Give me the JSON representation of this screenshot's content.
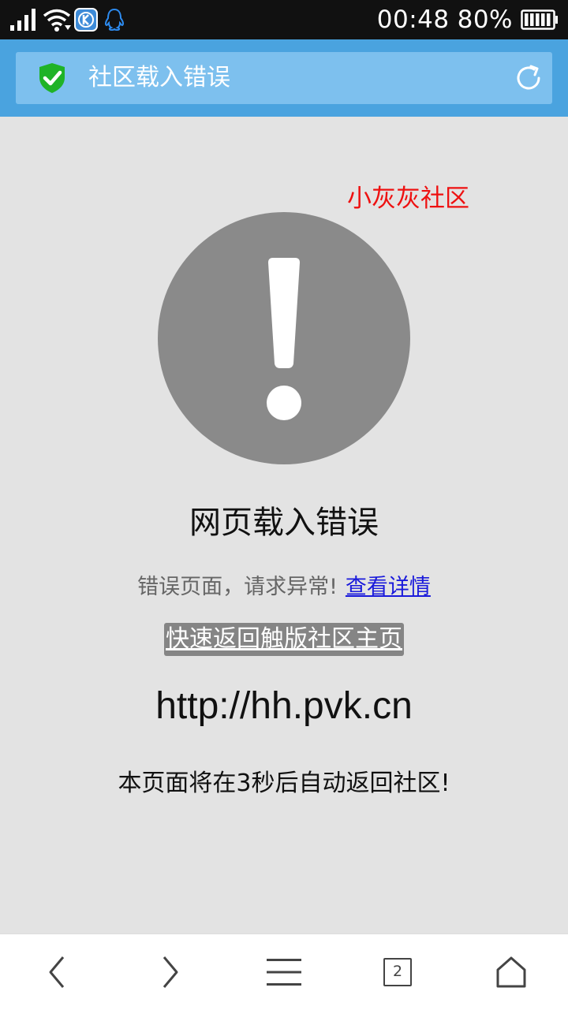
{
  "status_bar": {
    "clock": "00:48",
    "battery_percent": "80%",
    "icons": [
      "signal-icon",
      "wifi-icon",
      "k-app-icon",
      "qq-icon",
      "battery-icon"
    ]
  },
  "browser": {
    "page_title": "社区载入错误",
    "secure_icon": "shield-check-icon",
    "refresh_icon": "refresh-icon",
    "open_tab_count": "2",
    "nav_icons": [
      "back-icon",
      "forward-icon",
      "menu-icon",
      "tabs-icon",
      "home-icon"
    ]
  },
  "content": {
    "watermark": "小灰灰社区",
    "alert_icon": "exclamation-circle-icon",
    "heading": "网页载入错误",
    "description": "错误页面，请求异常!",
    "details_link": "查看详情",
    "back_button": "快速返回触版社区主页",
    "url": "http://hh.pvk.cn",
    "countdown": "本页面将在3秒后自动返回社区!"
  },
  "colors": {
    "status_bar_bg": "#111111",
    "url_bar_bg": "#4aa3df",
    "url_field_bg": "#7dc0ee",
    "page_bg": "#e3e3e3",
    "watermark": "#ee1111",
    "link": "#1a1adb",
    "alert_circle": "#8a8a8a",
    "back_button_bg": "#858585"
  }
}
